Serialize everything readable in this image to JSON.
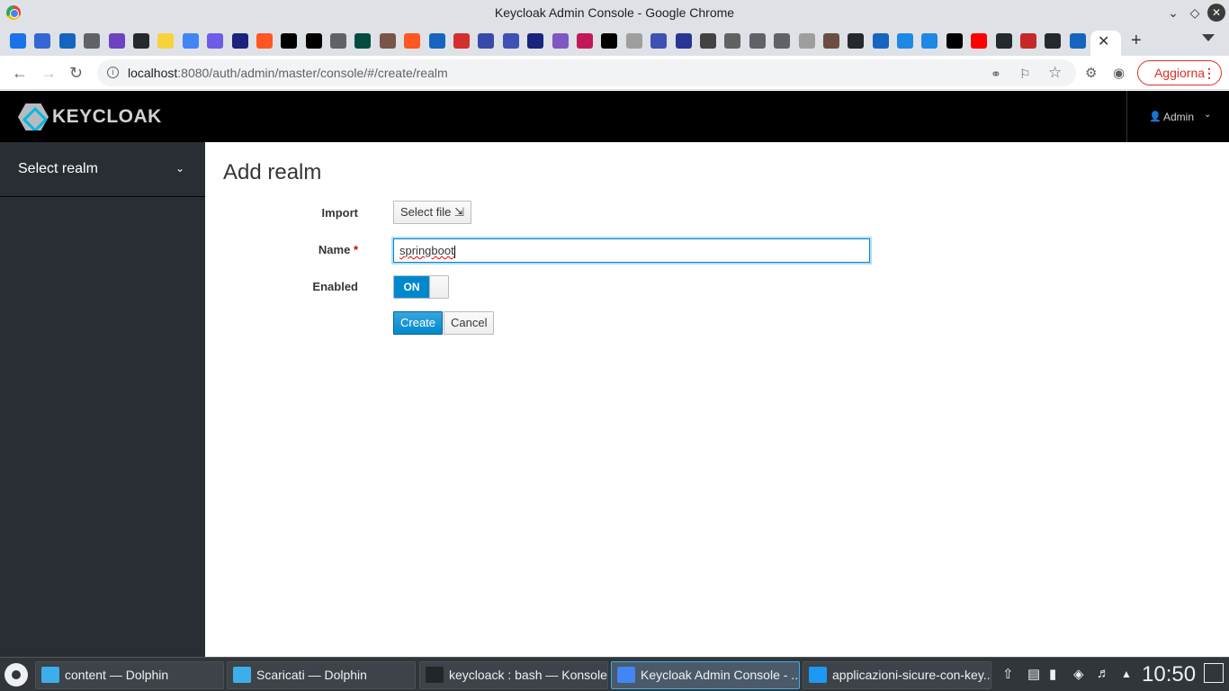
{
  "window": {
    "title": "Keycloak Admin Console - Google Chrome"
  },
  "browser": {
    "url_host": "localhost",
    "url_rest": ":8080/auth/admin/master/console/#/create/realm",
    "update_label": "Aggiorna",
    "tab_icon_colors": [
      "#1a73e8",
      "#3367d6",
      "#1565c0",
      "#5f6368",
      "#6f42c1",
      "#24292e",
      "#f7d33b",
      "#4285f4",
      "#6c5ce7",
      "#1a237e",
      "#ff5722",
      "#000000",
      "#000000",
      "#5f6368",
      "#004d40",
      "#795548",
      "#ff5722",
      "#1565c0",
      "#d32f2f",
      "#3949ab",
      "#3f51b5",
      "#1a237e",
      "#7e57c2",
      "#c2185b",
      "#000000",
      "#9e9e9e",
      "#3f51b5",
      "#283593",
      "#424242",
      "#616161",
      "#5f6368",
      "#5f6368",
      "#9e9e9e",
      "#6d4c41",
      "#24292e",
      "#1565c0",
      "#1e88e5",
      "#1e88e5",
      "#000000",
      "#ff0000",
      "#24292e",
      "#c62828",
      "#24292e",
      "#1565c0"
    ]
  },
  "app": {
    "brand": "KEYCLOAK",
    "user": "Admin",
    "realm_selector": "Select realm"
  },
  "form": {
    "title": "Add realm",
    "import_label": "Import",
    "select_file_label": "Select file",
    "name_label": "Name",
    "required_mark": "*",
    "name_value": "springboot",
    "enabled_label": "Enabled",
    "enabled_state": "ON",
    "create_label": "Create",
    "cancel_label": "Cancel"
  },
  "taskbar": {
    "tasks": [
      {
        "label": "content — Dolphin",
        "icon_color": "#3daee9"
      },
      {
        "label": "Scaricati — Dolphin",
        "icon_color": "#3daee9"
      },
      {
        "label": "keycloack : bash — Konsole",
        "icon_color": "#232629"
      },
      {
        "label": "Keycloak Admin Console - ...",
        "icon_color": "#4285f4"
      },
      {
        "label": "applicazioni-sicure-con-key...",
        "icon_color": "#1d99f3"
      }
    ],
    "clock": "10:50"
  }
}
